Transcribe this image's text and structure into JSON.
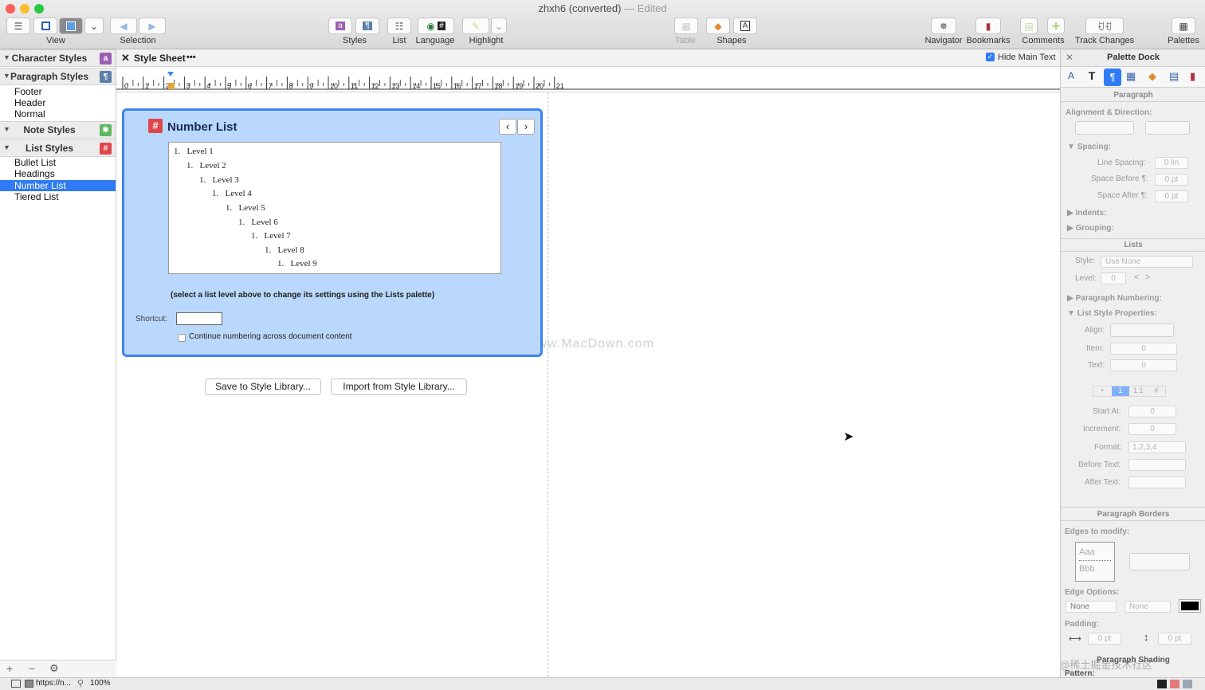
{
  "window": {
    "title": "zhxh6 (converted)",
    "status": "— Edited"
  },
  "toolbar": {
    "view_label": "View",
    "selection_label": "Selection",
    "styles_label": "Styles",
    "list_label": "List",
    "language_label": "Language",
    "highlight_label": "Highlight",
    "table_label": "Table",
    "shapes_label": "Shapes",
    "navigator_label": "Navigator",
    "bookmarks_label": "Bookmarks",
    "comments_label": "Comments",
    "track_changes_label": "Track Changes",
    "palettes_label": "Palettes"
  },
  "sidebar": {
    "character_styles": "Character Styles",
    "paragraph_styles": "Paragraph Styles",
    "paragraph_items": [
      "Footer",
      "Header",
      "Normal"
    ],
    "note_styles": "Note Styles",
    "list_styles": "List Styles",
    "list_items": [
      "Bullet List",
      "Headings",
      "Number List",
      "Tiered List"
    ],
    "selected_list_item": "Number List"
  },
  "editor": {
    "tab_title": "Style Sheet",
    "tab_more": "•••",
    "hide_main_text": "Hide Main Text",
    "ruler_ticks": [
      "0",
      "1",
      "2",
      "3",
      "4",
      "5",
      "6",
      "7",
      "8",
      "9",
      "10",
      "11",
      "12",
      "13",
      "14",
      "15",
      "16",
      "17",
      "18",
      "19",
      "20",
      "21"
    ]
  },
  "style_panel": {
    "title": "Number List",
    "levels": [
      {
        "marker": "1.",
        "text": "Level 1"
      },
      {
        "marker": "1.",
        "text": "Level 2"
      },
      {
        "marker": "1.",
        "text": "Level 3"
      },
      {
        "marker": "1.",
        "text": "Level 4"
      },
      {
        "marker": "1.",
        "text": "Level 5"
      },
      {
        "marker": "1.",
        "text": "Level 6"
      },
      {
        "marker": "1.",
        "text": "Level 7"
      },
      {
        "marker": "1.",
        "text": "Level 8"
      },
      {
        "marker": "1.",
        "text": "Level 9"
      }
    ],
    "hint": "(select a list level above to change its settings using the Lists palette)",
    "shortcut_label": "Shortcut:",
    "shortcut_value": "",
    "continue_numbering": "Continue numbering across document content"
  },
  "buttons": {
    "save_library": "Save to Style Library...",
    "import_library": "Import from Style Library..."
  },
  "watermark": "www.MacDown.com",
  "dock": {
    "title": "Palette Dock",
    "paragraph": "Paragraph",
    "alignment_direction": "Alignment & Direction:",
    "spacing": "Spacing:",
    "line_spacing": "Line Spacing:",
    "line_spacing_value": "0 lin",
    "space_before": "Space Before ¶:",
    "space_before_value": "0 pt",
    "space_after": "Space After ¶:",
    "space_after_value": "0 pt",
    "indents": "Indents:",
    "grouping": "Grouping:",
    "lists": "Lists",
    "style": "Style:",
    "style_value": "Use None",
    "level": "Level:",
    "level_value": "0",
    "paragraph_numbering": "Paragraph Numbering:",
    "list_style_properties": "List Style Properties:",
    "align": "Align:",
    "item": "Item:",
    "item_value": "0",
    "text": "Text:",
    "text_value": "0",
    "numbering_tabs": [
      "•",
      "1",
      "1.1",
      "#"
    ],
    "start_at": "Start At:",
    "start_at_value": "0",
    "increment": "Increment:",
    "increment_value": "0",
    "format": "Format:",
    "format_value": "1,2,3,4",
    "before_text": "Before Text:",
    "after_text": "After Text:",
    "paragraph_borders": "Paragraph Borders",
    "edges_to_modify": "Edges to modify:",
    "edge_preview_1": "Aaa",
    "edge_preview_2": "Bbb",
    "edge_options": "Edge Options:",
    "edge_option_1": "None",
    "edge_option_2": "None",
    "padding": "Padding:",
    "padding_h_value": "0 pt",
    "padding_v_value": "0 pt",
    "paragraph_shading": "Paragraph Shading",
    "pattern": "Pattern:"
  },
  "statusbar": {
    "url": "https://n...",
    "zoom": "100%"
  },
  "corner_watermark": "@稀土掘金技术社区",
  "colors": {
    "accent": "#2f7bf5",
    "panel_bg": "#b9d8fb",
    "panel_border": "#3d82f0",
    "list_icon": "#e0474c",
    "char_icon": "#9b5fb0",
    "note_icon": "#5cb85c"
  }
}
